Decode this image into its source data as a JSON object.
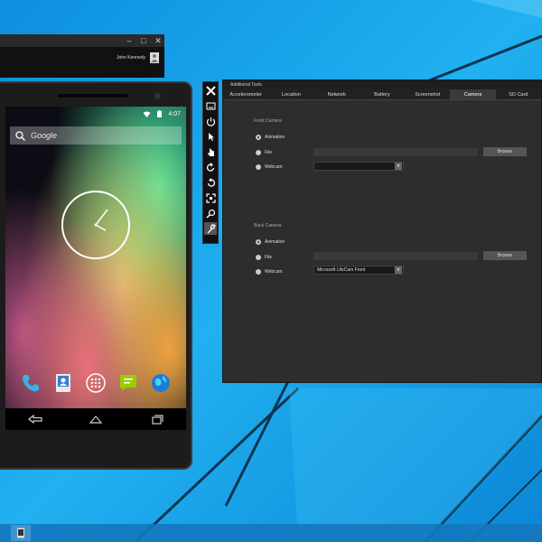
{
  "colors": {
    "desktop": "#1aa3e8",
    "panel": "#2d2d2d",
    "accent_tab": "#3a3a3a"
  },
  "bg_window": {
    "user_name": "John Kennedy",
    "icons": [
      "minimize-icon",
      "maximize-icon",
      "close-icon"
    ]
  },
  "phone": {
    "status_time": "4:07",
    "search_placeholder": "Google",
    "dock_icons": [
      "phone-icon",
      "contacts-icon",
      "apps-icon",
      "messaging-icon",
      "browser-icon"
    ],
    "nav_icons": [
      "back-icon",
      "home-icon",
      "recents-icon"
    ]
  },
  "toolbar": {
    "items": [
      {
        "name": "close",
        "glyph": "✕"
      },
      {
        "name": "screen",
        "glyph": ""
      },
      {
        "name": "power",
        "glyph": ""
      },
      {
        "name": "pointer",
        "glyph": ""
      },
      {
        "name": "touch",
        "glyph": ""
      },
      {
        "name": "rotate-left",
        "glyph": ""
      },
      {
        "name": "rotate-right",
        "glyph": ""
      },
      {
        "name": "fit",
        "glyph": ""
      },
      {
        "name": "zoom",
        "glyph": ""
      },
      {
        "name": "tools",
        "glyph": ""
      }
    ]
  },
  "tools": {
    "title": "Additional Tools",
    "tabs": [
      "Accelerometer",
      "Location",
      "Network",
      "Battery",
      "Screenshot",
      "Camera",
      "SD Card"
    ],
    "active_tab": "Camera",
    "front": {
      "label": "Front Camera",
      "option1": "Animation",
      "option2": "File",
      "option3": "Webcam",
      "browse": "Browse",
      "webcam_value": ""
    },
    "back": {
      "label": "Back Camera",
      "option1": "Animation",
      "option2": "File",
      "option3": "Webcam",
      "browse": "Browse",
      "webcam_value": "Microsoft LifeCam Front"
    }
  },
  "taskbar": {
    "app_icon": "emulator-icon"
  }
}
